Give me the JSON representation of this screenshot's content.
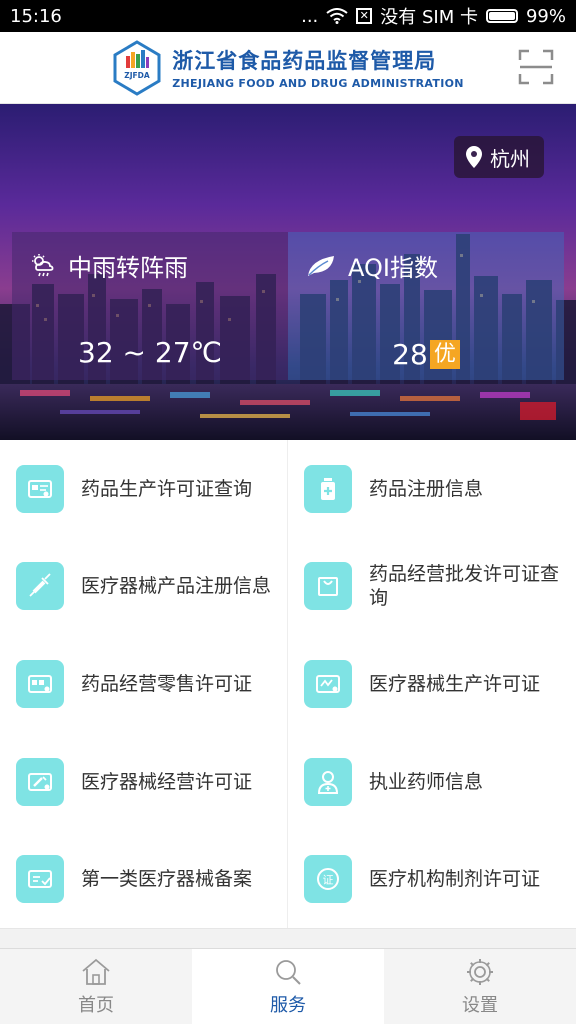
{
  "status_bar": {
    "time": "15:16",
    "dots": "...",
    "carrier": "没有 SIM 卡",
    "battery": "99%"
  },
  "header": {
    "logo_abbr": "ZJFDA",
    "title_cn": "浙江省食品药品监督管理局",
    "title_en": "ZHEJIANG FOOD AND DRUG ADMINISTRATION",
    "scan_icon": "scan-icon"
  },
  "hero": {
    "location": "杭州",
    "weather": {
      "condition": "中雨转阵雨",
      "temperature": "32 ~ 27℃",
      "icon": "cloud-rain-icon"
    },
    "aqi": {
      "label": "AQI指数",
      "value": "28",
      "level": "优",
      "icon": "leaf-icon"
    }
  },
  "services": [
    {
      "label": "药品生产许可证查询",
      "icon": "license-card-icon"
    },
    {
      "label": "药品注册信息",
      "icon": "medicine-bottle-icon"
    },
    {
      "label": "医疗器械产品注册信息",
      "icon": "syringe-icon"
    },
    {
      "label": "药品经营批发许可证查询",
      "icon": "shopping-bag-icon"
    },
    {
      "label": "药品经营零售许可证",
      "icon": "retail-license-icon"
    },
    {
      "label": "医疗器械生产许可证",
      "icon": "production-license-icon"
    },
    {
      "label": "医疗器械经营许可证",
      "icon": "operation-license-icon"
    },
    {
      "label": "执业药师信息",
      "icon": "pharmacist-icon"
    },
    {
      "label": "第一类医疗器械备案",
      "icon": "record-icon"
    },
    {
      "label": "医疗机构制剂许可证",
      "icon": "certificate-icon"
    }
  ],
  "tabs": [
    {
      "label": "首页",
      "icon": "home-icon",
      "active": false
    },
    {
      "label": "服务",
      "icon": "search-icon",
      "active": true
    },
    {
      "label": "设置",
      "icon": "gear-icon",
      "active": false
    }
  ],
  "colors": {
    "brand": "#1e5aa8",
    "icon_tile": "#7fe3e4",
    "aqi_badge": "#f5a623"
  }
}
